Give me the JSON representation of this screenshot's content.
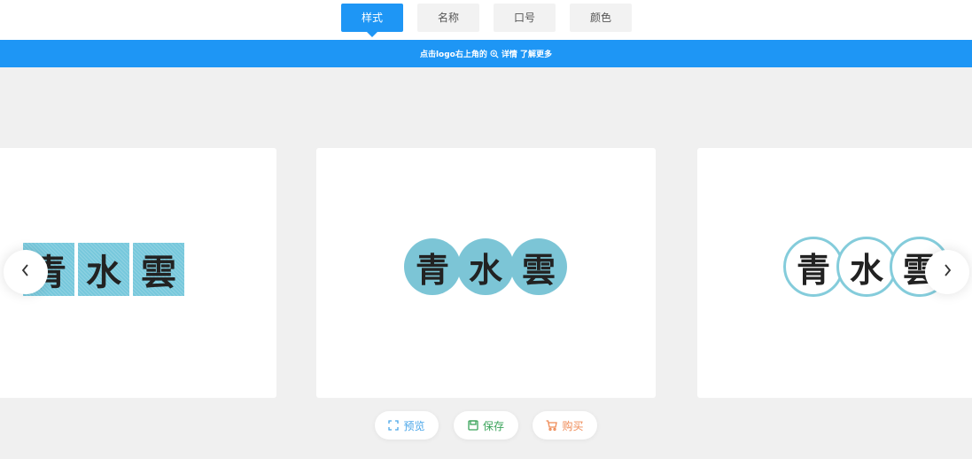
{
  "tabs": [
    {
      "label": "样式",
      "active": true
    },
    {
      "label": "名称",
      "active": false
    },
    {
      "label": "口号",
      "active": false
    },
    {
      "label": "颜色",
      "active": false
    }
  ],
  "info_bar": {
    "text_before": "点击logo右上角的",
    "icon": "zoom-in-icon",
    "text_after": "详情 了解更多"
  },
  "logo": {
    "chars": [
      "青",
      "水",
      "雲"
    ]
  },
  "cards": [
    {
      "style": "square-tiles",
      "color": "#77c8dc"
    },
    {
      "style": "filled-circles",
      "color": "#7cc5d6"
    },
    {
      "style": "outlined-circles",
      "color": "#84ccdb"
    }
  ],
  "nav": {
    "prev_icon": "chevron-left-icon",
    "next_icon": "chevron-right-icon"
  },
  "actions": {
    "preview": {
      "label": "预览",
      "icon": "expand-icon",
      "color": "#4aa6e8"
    },
    "save": {
      "label": "保存",
      "icon": "save-icon",
      "color": "#3aa35a"
    },
    "buy": {
      "label": "购买",
      "icon": "cart-icon",
      "color": "#ef8a55"
    }
  },
  "colors": {
    "accent": "#1e96f5",
    "background": "#f0f0f0"
  }
}
